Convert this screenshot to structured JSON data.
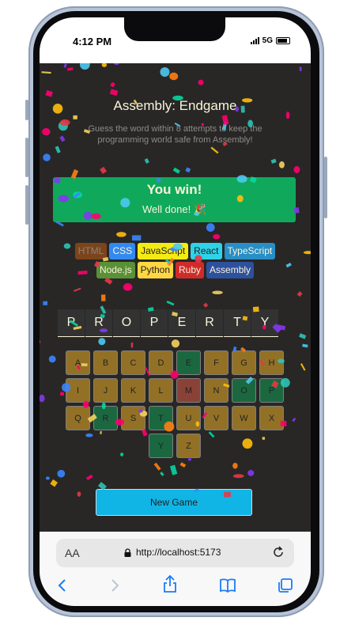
{
  "status": {
    "time": "4:12 PM",
    "network": "5G"
  },
  "game": {
    "title": "Assembly: Endgame",
    "subtitle": "Guess the word within 8 attempts to keep the programming world safe from Assembly!",
    "win_title": "You win!",
    "win_message": "Well done! 🎉",
    "languages": [
      {
        "name": "HTML",
        "bg": "#E2680F",
        "fg": "#F9F4DA",
        "lost": true
      },
      {
        "name": "CSS",
        "bg": "#328AF1",
        "fg": "#F9F4DA",
        "lost": false
      },
      {
        "name": "JavaScript",
        "bg": "#F4EB13",
        "fg": "#1E1E1E",
        "lost": false
      },
      {
        "name": "React",
        "bg": "#2ED3E9",
        "fg": "#1E1E1E",
        "lost": false
      },
      {
        "name": "TypeScript",
        "bg": "#298EC6",
        "fg": "#F9F4DA",
        "lost": false
      },
      {
        "name": "Node.js",
        "bg": "#599137",
        "fg": "#F9F4DA",
        "lost": false
      },
      {
        "name": "Python",
        "bg": "#FFD742",
        "fg": "#1E1E1E",
        "lost": false
      },
      {
        "name": "Ruby",
        "bg": "#D02B2B",
        "fg": "#F9F4DA",
        "lost": false
      },
      {
        "name": "Assembly",
        "bg": "#2D519F",
        "fg": "#F9F4DA",
        "lost": false
      }
    ],
    "word": [
      "P",
      "R",
      "O",
      "P",
      "E",
      "R",
      "T",
      "Y"
    ],
    "keyboard": [
      "A",
      "B",
      "C",
      "D",
      "E",
      "F",
      "G",
      "H",
      "I",
      "J",
      "K",
      "L",
      "M",
      "N",
      "O",
      "P",
      "Q",
      "R",
      "S",
      "T",
      "U",
      "V",
      "W",
      "X",
      "Y",
      "Z"
    ],
    "correct_keys": [
      "E",
      "O",
      "P",
      "R",
      "T",
      "Y"
    ],
    "wrong_keys": [
      "M"
    ],
    "new_game_label": "New Game"
  },
  "browser": {
    "text_size_label": "AA",
    "url": "http://localhost:5173"
  },
  "colors": {
    "background": "#282726",
    "correct": "#10A95B",
    "wrong": "#EC5D49",
    "key": "#FCBA29",
    "new_game": "#11B5E5"
  }
}
